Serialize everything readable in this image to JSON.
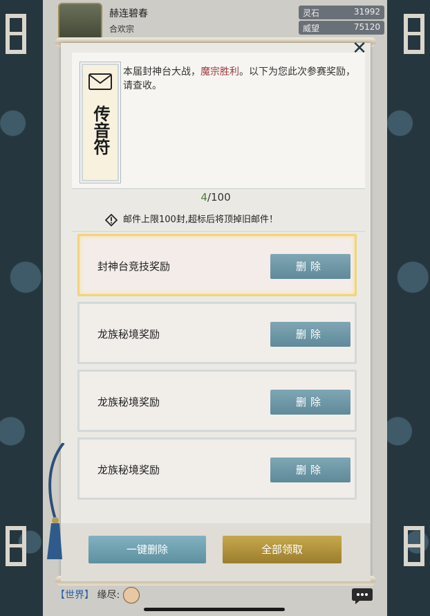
{
  "player": {
    "name": "赫连碧春",
    "sect": "合欢宗"
  },
  "stats": [
    {
      "label": "灵石",
      "value": "31992"
    },
    {
      "label": "威望",
      "value": "75120"
    }
  ],
  "header": {
    "talisman_text": "传音符",
    "message_before": "本届封神台大战，",
    "message_highlight": "魔宗胜利",
    "message_after": "。以下为您此次参赛奖励，请查收。"
  },
  "counter": {
    "current": "4",
    "total": "/100"
  },
  "warning": "邮件上限100封,超标后将顶掉旧邮件！",
  "mails": [
    {
      "title": "封神台竞技奖励",
      "delete_label": "删除"
    },
    {
      "title": "龙族秘境奖励",
      "delete_label": "删除"
    },
    {
      "title": "龙族秘境奖励",
      "delete_label": "删除"
    },
    {
      "title": "龙族秘境奖励",
      "delete_label": "删除"
    }
  ],
  "footer": {
    "delete_all": "一键删除",
    "claim_all": "全部领取"
  },
  "chat": {
    "channel": "【世界】",
    "speaker": "缘尽:"
  },
  "colors": {
    "highlight": "#9c3b3b",
    "counter_current": "#4f7d34",
    "delete_button": "#6b95a5",
    "claim_button": "#b39440",
    "selected_border": "#f2d47a"
  }
}
